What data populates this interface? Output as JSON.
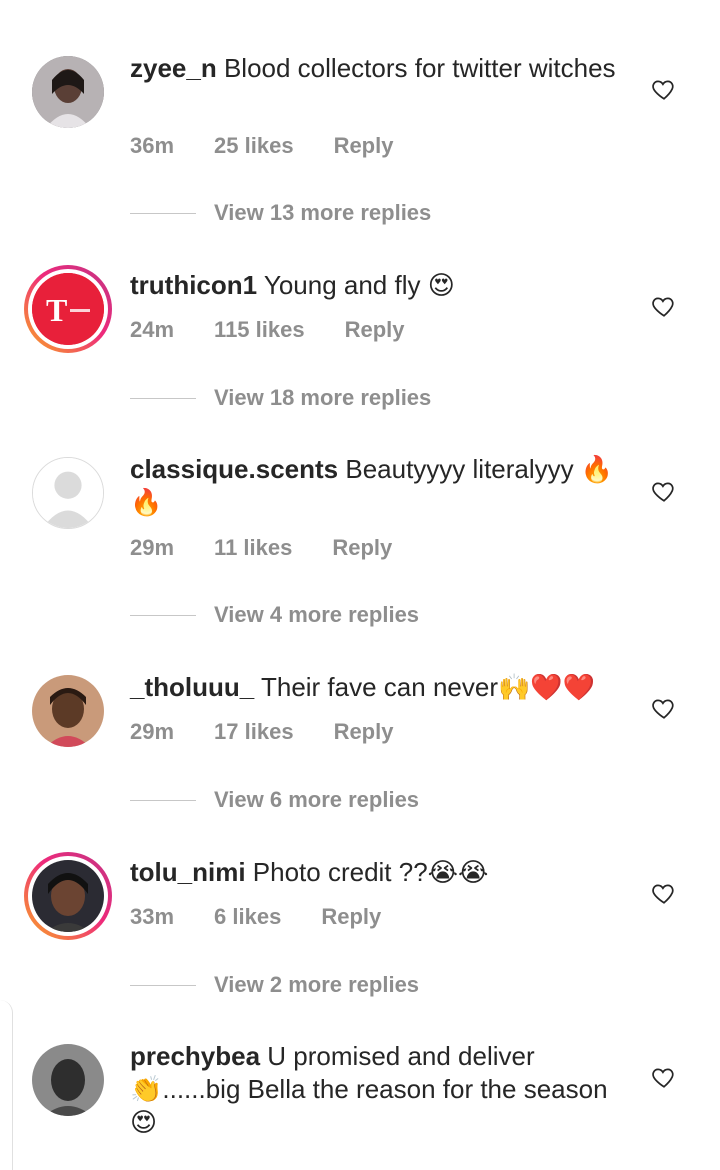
{
  "comments": [
    {
      "username": "zyee_n",
      "text": " Blood collectors for twitter witches",
      "time": "36m",
      "likes": "25 likes",
      "reply": "Reply",
      "view_replies": "View 13 more replies"
    },
    {
      "username": "truthicon1",
      "text": " Young and fly 😍",
      "time": "24m",
      "likes": "115 likes",
      "reply": "Reply",
      "view_replies": "View 18 more replies"
    },
    {
      "username": "classique.scents",
      "text": " Beautyyyy literalyyy 🔥 🔥",
      "time": "29m",
      "likes": "11 likes",
      "reply": "Reply",
      "view_replies": "View 4 more replies"
    },
    {
      "username": "_tholuuu_",
      "text": " Their fave can never🙌❤️❤️",
      "time": "29m",
      "likes": "17 likes",
      "reply": "Reply",
      "view_replies": "View 6 more replies"
    },
    {
      "username": "tolu_nimi",
      "text": " Photo credit ??😭😭",
      "time": "33m",
      "likes": "6 likes",
      "reply": "Reply",
      "view_replies": "View 2 more replies"
    },
    {
      "username": "prechybea",
      "text": " U promised and deliver 👏......big Bella the reason for the season😍",
      "time": "",
      "likes": "",
      "reply": ""
    }
  ],
  "icons": {
    "like": "heart-outline-icon"
  },
  "colors": {
    "meta_gray": "#8e8e8e",
    "story_ring_start": "#f9a825",
    "story_ring_end": "#c13584",
    "truthicon_red": "#e8203a"
  }
}
